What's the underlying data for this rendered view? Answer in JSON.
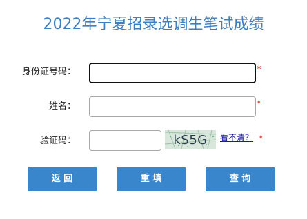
{
  "page": {
    "title": "2022年宁夏招录选调生笔试成绩"
  },
  "form": {
    "id_label": "身份证号码：",
    "id_value": "",
    "name_label": "姓名：",
    "name_value": "",
    "captcha_label": "验证码：",
    "captcha_value": "",
    "captcha_text": "kS5G",
    "refresh_link": "看不清？",
    "required_mark": "*"
  },
  "buttons": {
    "back": "返 回",
    "reset": "重 填",
    "query": "查 询"
  },
  "colors": {
    "title": "#3d7fc1",
    "button": "#3a86cc",
    "required": "#e02020",
    "link": "#1a1aa8"
  }
}
